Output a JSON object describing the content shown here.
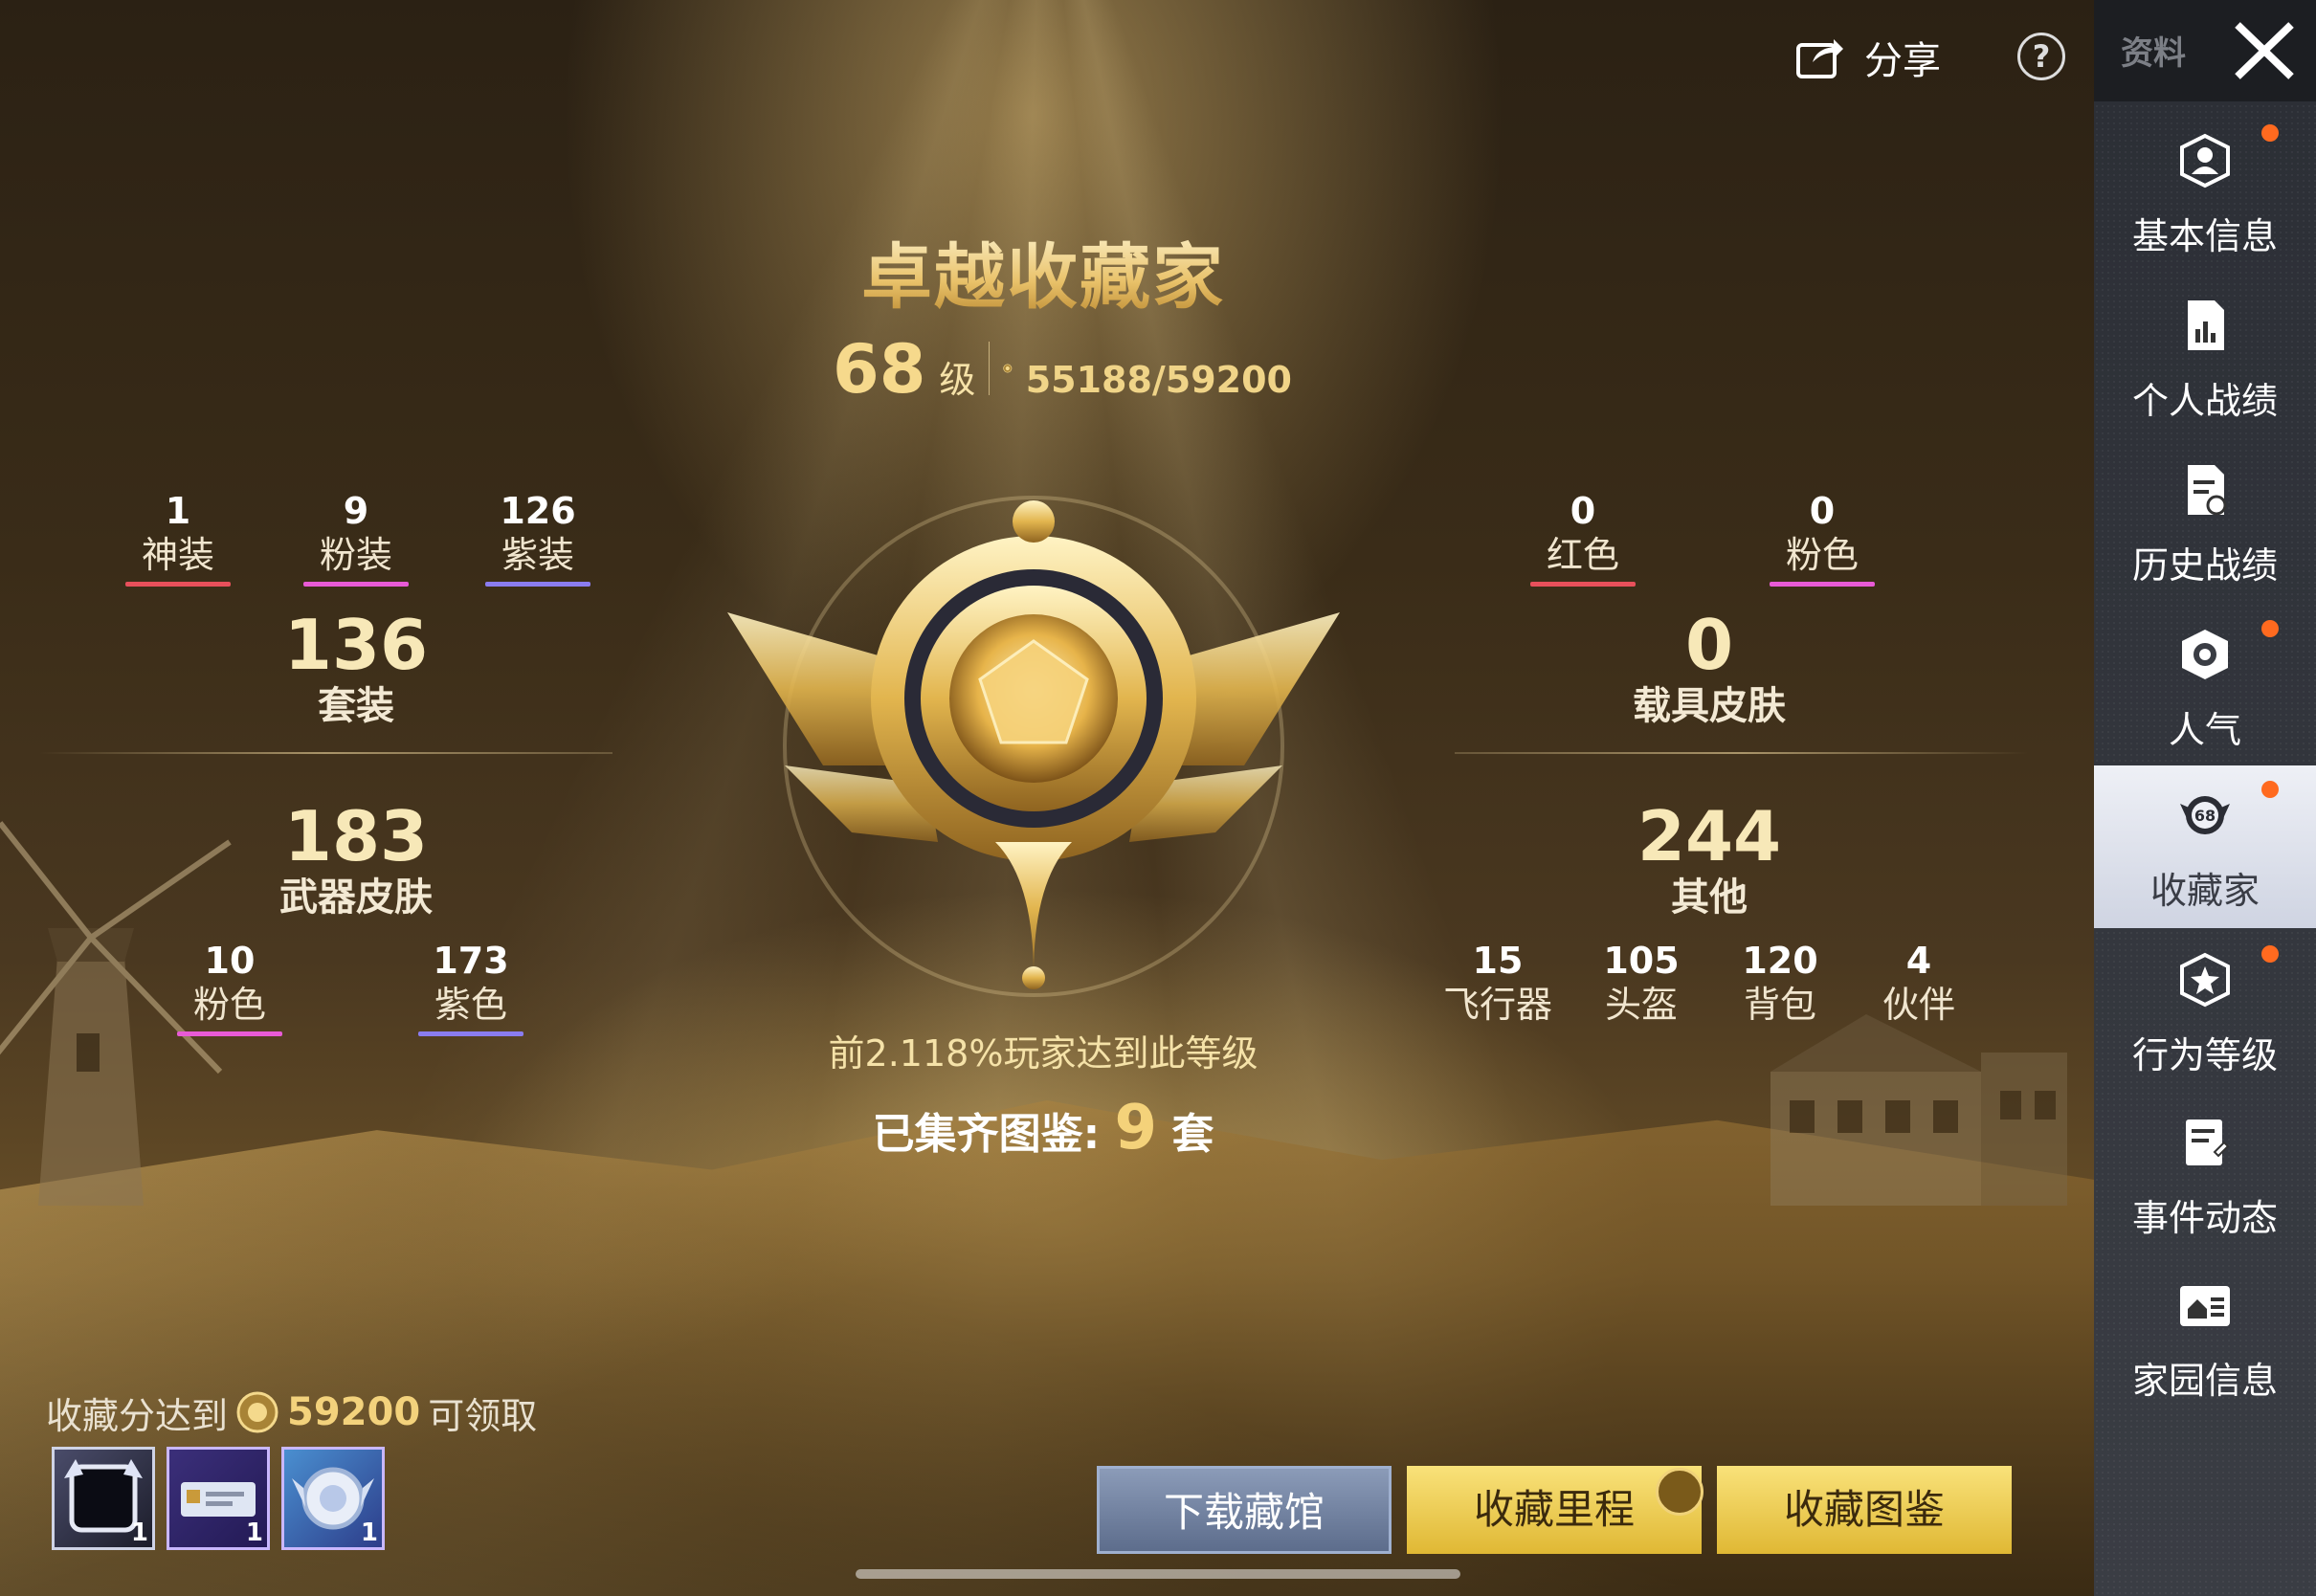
{
  "header": {
    "share_label": "分享",
    "help_label": "?"
  },
  "title": "卓越收藏家",
  "level": {
    "number": "68",
    "unit": "级",
    "score": "55188/59200"
  },
  "left_top": [
    {
      "value": "1",
      "label": "神装",
      "color": "#e8505b"
    },
    {
      "value": "9",
      "label": "粉装",
      "color": "#e85ad6"
    },
    {
      "value": "126",
      "label": "紫装",
      "color": "#8a7cf0"
    }
  ],
  "suits": {
    "value": "136",
    "label": "套装"
  },
  "weapon": {
    "value": "183",
    "label": "武器皮肤"
  },
  "weapon_sub": [
    {
      "value": "10",
      "label": "粉色",
      "color": "#e85ad6"
    },
    {
      "value": "173",
      "label": "紫色",
      "color": "#8a7cf0"
    }
  ],
  "right_top": [
    {
      "value": "0",
      "label": "红色",
      "color": "#e8505b"
    },
    {
      "value": "0",
      "label": "粉色",
      "color": "#e85ad6"
    }
  ],
  "vehicle": {
    "value": "0",
    "label": "载具皮肤"
  },
  "other": {
    "value": "244",
    "label": "其他"
  },
  "other_sub": [
    {
      "value": "15",
      "label": "飞行器"
    },
    {
      "value": "105",
      "label": "头盔"
    },
    {
      "value": "120",
      "label": "背包"
    },
    {
      "value": "4",
      "label": "伙伴"
    }
  ],
  "percent_text": "前2.118%玩家达到此等级",
  "sets": {
    "prefix": "已集齐图鉴:",
    "count": "9",
    "suffix": "套"
  },
  "reward": {
    "prefix": "收藏分达到",
    "value": "59200",
    "suffix": "可领取",
    "items": [
      {
        "qty": "1"
      },
      {
        "qty": "1"
      },
      {
        "qty": "1"
      }
    ]
  },
  "buttons": {
    "download": "下载藏馆",
    "milestone": "收藏里程",
    "atlas": "收藏图鉴"
  },
  "sidebar": {
    "top_label": "资料",
    "items": [
      {
        "label": "基本信息",
        "icon": "profile-icon",
        "dot": true
      },
      {
        "label": "个人战绩",
        "icon": "stats-icon",
        "dot": false
      },
      {
        "label": "历史战绩",
        "icon": "history-icon",
        "dot": false
      },
      {
        "label": "人气",
        "icon": "popularity-icon",
        "dot": true
      },
      {
        "label": "收藏家",
        "icon": "collector-badge-icon",
        "dot": true,
        "active": true,
        "badge": "68"
      },
      {
        "label": "行为等级",
        "icon": "behavior-icon",
        "dot": true
      },
      {
        "label": "事件动态",
        "icon": "event-icon",
        "dot": false
      },
      {
        "label": "家园信息",
        "icon": "home-icon",
        "dot": false
      }
    ]
  }
}
